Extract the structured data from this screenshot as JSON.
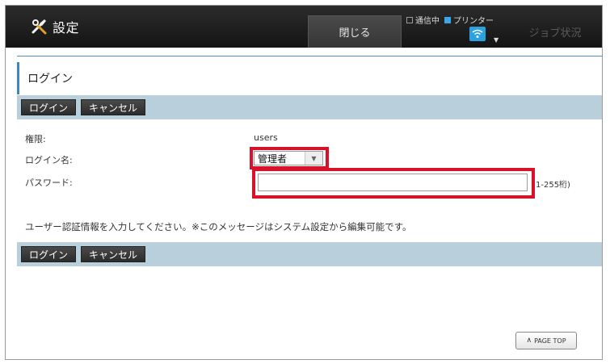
{
  "header": {
    "title": "設定",
    "close_label": "閉じる",
    "status_comm": "通信中",
    "status_printer": "プリンター",
    "job_status_label": "ジョブ状況",
    "printer_color": "#3aa8e8"
  },
  "page": {
    "title": "ログイン",
    "accent_color": "#3b86c8"
  },
  "toolbar": {
    "login_label": "ログイン",
    "cancel_label": "キャンセル"
  },
  "form": {
    "authority_label": "権限:",
    "authority_value": "users",
    "login_name_label": "ログイン名:",
    "login_name_value": "管理者",
    "password_label": "パスワード:",
    "password_value": "",
    "password_hint": "1-255桁)"
  },
  "message": "ユーザー認証情報を入力してください。※このメッセージはシステム設定から編集可能です。",
  "footer": {
    "page_top_label": "PAGE TOP"
  },
  "highlight_color": "#d9112a"
}
